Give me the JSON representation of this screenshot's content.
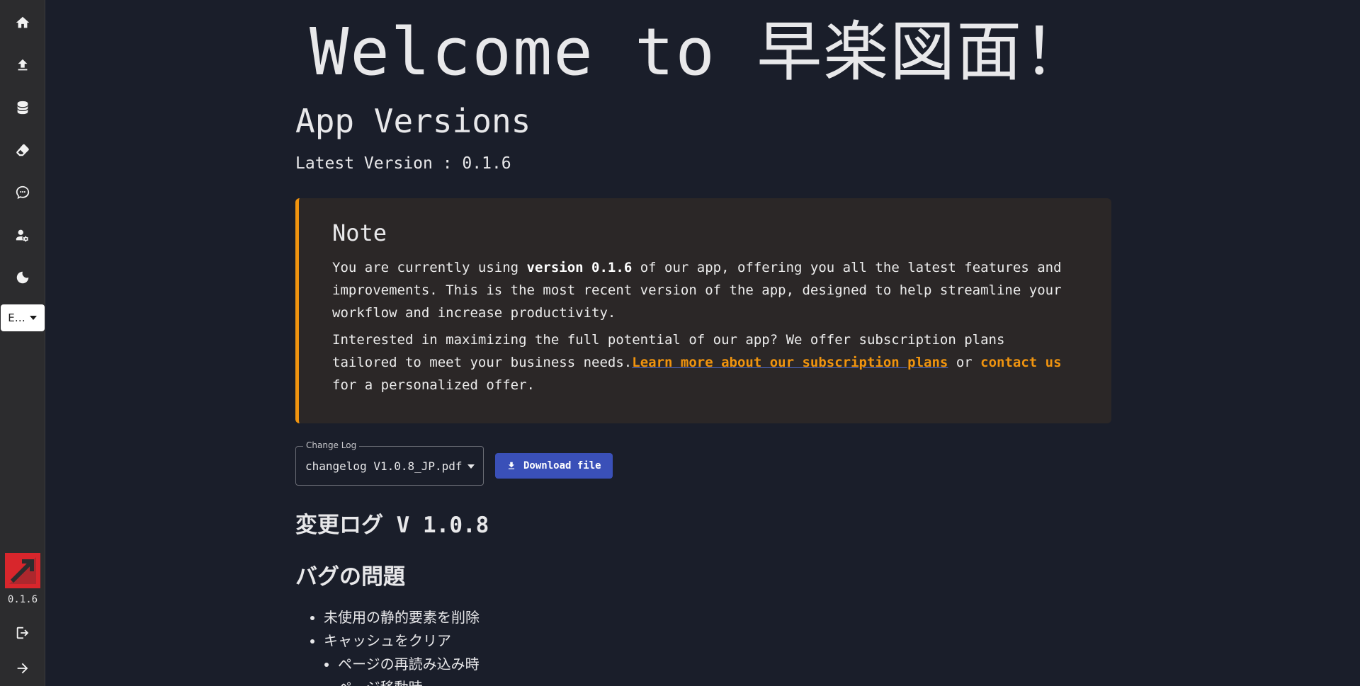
{
  "sidebar": {
    "nav": [
      {
        "name": "home-icon",
        "label": "Home"
      },
      {
        "name": "upload-icon",
        "label": "Upload"
      },
      {
        "name": "database-icon",
        "label": "Database"
      },
      {
        "name": "eraser-icon",
        "label": "Eraser"
      },
      {
        "name": "chat-icon",
        "label": "Chat"
      },
      {
        "name": "user-settings-icon",
        "label": "User settings"
      },
      {
        "name": "dark-mode-icon",
        "label": "Dark mode"
      }
    ],
    "language": "E…",
    "version": "0.1.6"
  },
  "main": {
    "welcome": "Welcome to 早楽図面！",
    "section_title": "App Versions",
    "latest_version": "Latest Version : 0.1.6",
    "note": {
      "title": "Note",
      "p1_before": "You are currently using ",
      "p1_bold": "version 0.1.6",
      "p1_after": " of our app, offering you all the latest features and improvements. This is the most recent version of the app, designed to help streamline your workflow and increase productivity.",
      "p2_before": "Interested in maximizing the full potential of our app? We offer subscription plans tailored to meet your business needs.",
      "p2_link1": "Learn more about our subscription plans",
      "p2_mid": " or ",
      "p2_link2": "contact us",
      "p2_after": " for a personalized offer."
    },
    "changelog": {
      "legend": "Change Log",
      "selected": "changelog V1.0.8_JP.pdf",
      "download_label": "Download file"
    },
    "doc": {
      "h1": "変更ログ V 1.0.8",
      "h2": "バグの問題",
      "items": [
        "未使用の静的要素を削除",
        "キャッシュをクリア"
      ],
      "subitems": [
        "ページの再読み込み時",
        "ページ移動時"
      ]
    }
  },
  "colors": {
    "background": "#1a1e2a",
    "sidebar": "#2c2c2e",
    "accent": "#f0940f",
    "button": "#3a50b8"
  }
}
